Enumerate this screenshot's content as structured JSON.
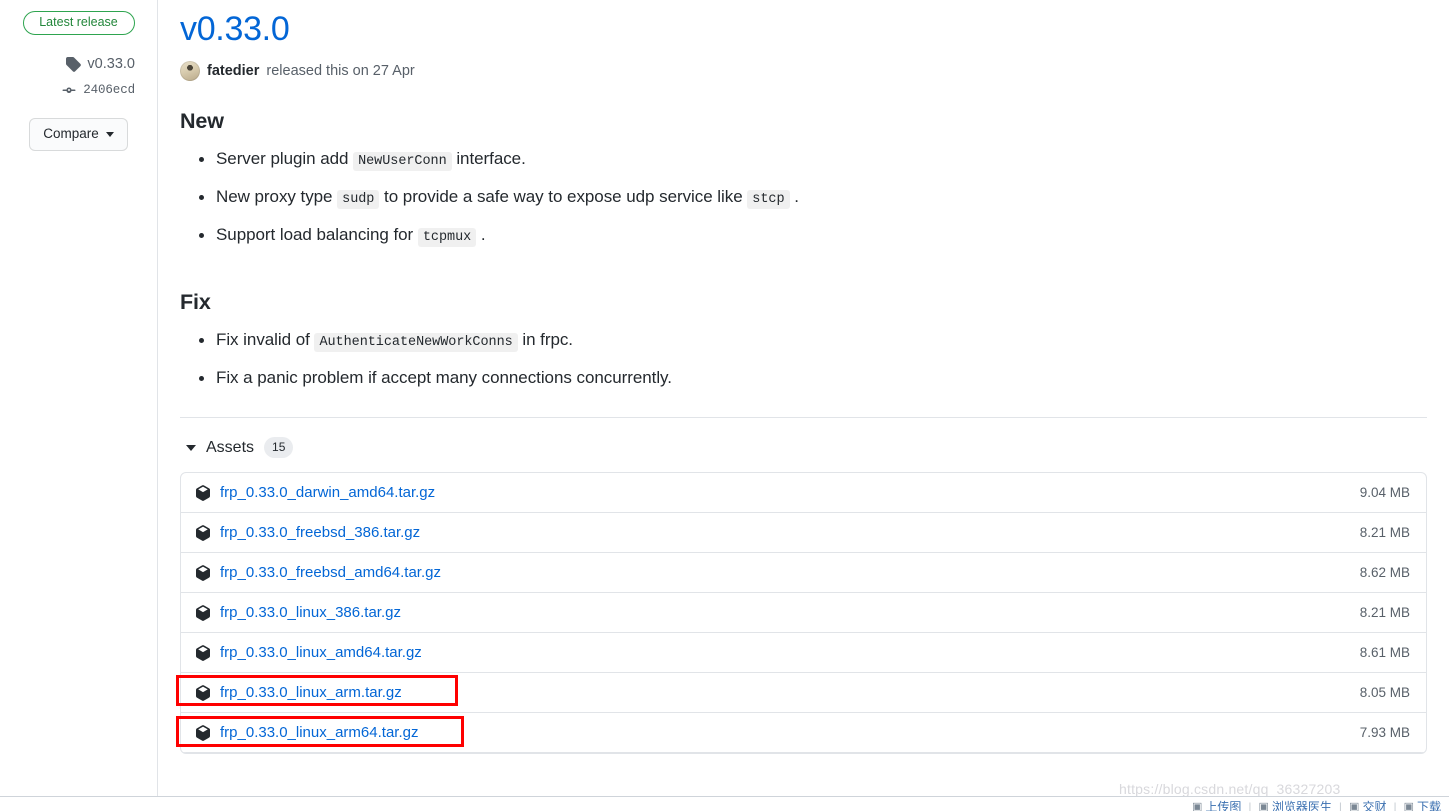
{
  "sidebar": {
    "latest_badge": "Latest release",
    "tag": {
      "icon": "tag-icon",
      "label": "v0.33.0"
    },
    "commit": {
      "icon": "commit-icon",
      "label": "2406ecd"
    },
    "compare_button": {
      "label": "Compare",
      "icon": "chevron-down-icon"
    }
  },
  "release": {
    "title": "v0.33.0",
    "author": "fatedier",
    "byline_rest": "released this on 27 Apr",
    "avatar": "user-avatar"
  },
  "sections": [
    {
      "heading": "New",
      "items": [
        [
          {
            "t": "Server plugin add "
          },
          {
            "code": "NewUserConn"
          },
          {
            "t": " interface."
          }
        ],
        [
          {
            "t": "New proxy type "
          },
          {
            "code": "sudp"
          },
          {
            "t": " to provide a safe way to expose udp service like "
          },
          {
            "code": "stcp"
          },
          {
            "t": " ."
          }
        ],
        [
          {
            "t": "Support load balancing for "
          },
          {
            "code": "tcpmux"
          },
          {
            "t": " ."
          }
        ]
      ]
    },
    {
      "heading": "Fix",
      "items": [
        [
          {
            "t": "Fix invalid of "
          },
          {
            "code": "AuthenticateNewWorkConns"
          },
          {
            "t": " in frpc."
          }
        ],
        [
          {
            "t": "Fix a panic problem if accept many connections concurrently."
          }
        ]
      ]
    }
  ],
  "assets": {
    "toggle_icon": "triangle-down-icon",
    "label": "Assets",
    "count": "15",
    "rows": [
      {
        "icon": "package-icon",
        "name": "frp_0.33.0_darwin_amd64.tar.gz",
        "size": "9.04 MB",
        "highlighted": false
      },
      {
        "icon": "package-icon",
        "name": "frp_0.33.0_freebsd_386.tar.gz",
        "size": "8.21 MB",
        "highlighted": false
      },
      {
        "icon": "package-icon",
        "name": "frp_0.33.0_freebsd_amd64.tar.gz",
        "size": "8.62 MB",
        "highlighted": false
      },
      {
        "icon": "package-icon",
        "name": "frp_0.33.0_linux_386.tar.gz",
        "size": "8.21 MB",
        "highlighted": false
      },
      {
        "icon": "package-icon",
        "name": "frp_0.33.0_linux_amd64.tar.gz",
        "size": "8.61 MB",
        "highlighted": true
      },
      {
        "icon": "package-icon",
        "name": "frp_0.33.0_linux_arm.tar.gz",
        "size": "8.05 MB",
        "highlighted": true
      },
      {
        "icon": "package-icon",
        "name": "frp_0.33.0_linux_arm64.tar.gz",
        "size": "7.93 MB",
        "highlighted": false
      }
    ]
  },
  "annotations": {
    "color": "#fe0000",
    "boxes": [
      "frp_0.33.0_linux_amd64.tar.gz",
      "frp_0.33.0_linux_arm.tar.gz"
    ]
  },
  "watermark": {
    "text": "https://blog.csdn.net/qq_36327203"
  },
  "taskbar": {
    "items": [
      {
        "icon": "picture-icon",
        "label": "上传图"
      },
      {
        "icon": "browser-icon",
        "label": "浏览器医生"
      },
      {
        "icon": "video-icon",
        "label": "交财"
      },
      {
        "icon": "download-icon",
        "label": "下载"
      }
    ]
  },
  "colors": {
    "link": "#0366d6",
    "green": "#2ea44f",
    "text": "#24292e",
    "muted": "#586069",
    "border": "#e1e4e8",
    "annotation": "#fe0000"
  }
}
